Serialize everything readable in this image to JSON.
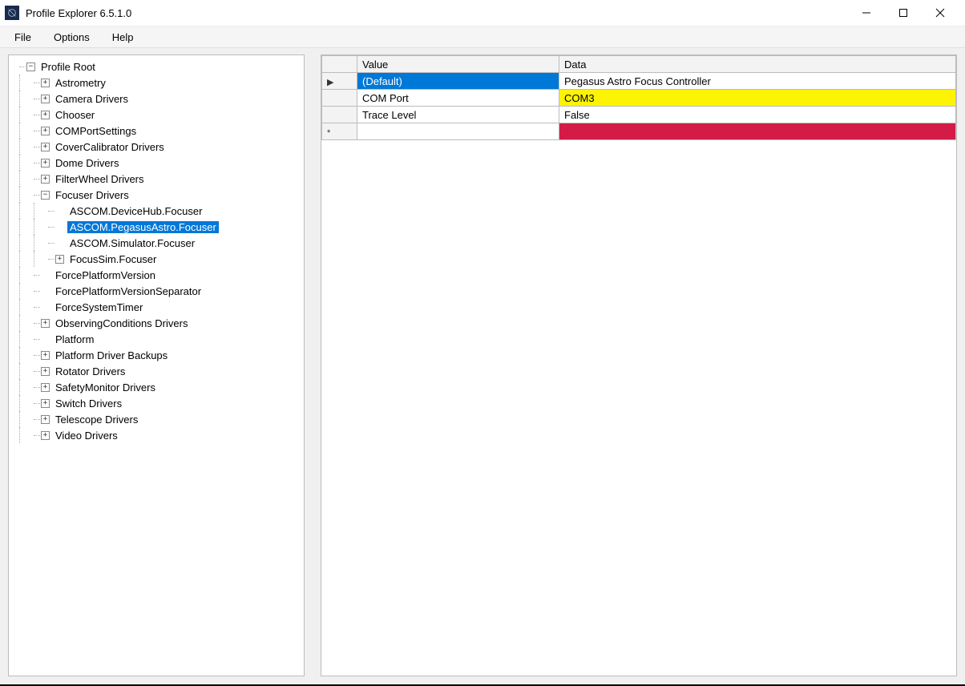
{
  "window": {
    "title": "Profile Explorer 6.5.1.0"
  },
  "menu": {
    "file": "File",
    "options": "Options",
    "help": "Help"
  },
  "tree": {
    "root": "Profile Root",
    "astrometry": "Astrometry",
    "camera": "Camera Drivers",
    "chooser": "Chooser",
    "comport": "COMPortSettings",
    "covercal": "CoverCalibrator Drivers",
    "dome": "Dome Drivers",
    "filterwheel": "FilterWheel Drivers",
    "focuser": "Focuser Drivers",
    "focuser_devicehub": "ASCOM.DeviceHub.Focuser",
    "focuser_pegasus": "ASCOM.PegasusAstro.Focuser",
    "focuser_simulator": "ASCOM.Simulator.Focuser",
    "focuser_focussim": "FocusSim.Focuser",
    "forceplat": "ForcePlatformVersion",
    "forceplatsep": "ForcePlatformVersionSeparator",
    "forcesystimer": "ForceSystemTimer",
    "obscond": "ObservingConditions Drivers",
    "platform": "Platform",
    "platbackup": "Platform Driver Backups",
    "rotator": "Rotator Drivers",
    "safety": "SafetyMonitor Drivers",
    "switch": "Switch Drivers",
    "telescope": "Telescope Drivers",
    "video": "Video Drivers"
  },
  "gridHeaders": {
    "value": "Value",
    "data": "Data"
  },
  "gridRows": {
    "r0": {
      "value": "(Default)",
      "data": "Pegasus Astro Focus Controller"
    },
    "r1": {
      "value": "COM Port",
      "data": "COM3"
    },
    "r2": {
      "value": "Trace Level",
      "data": "False"
    },
    "r3": {
      "value": "",
      "data": ""
    }
  },
  "glyphs": {
    "current": "▶",
    "newrow": "*"
  }
}
